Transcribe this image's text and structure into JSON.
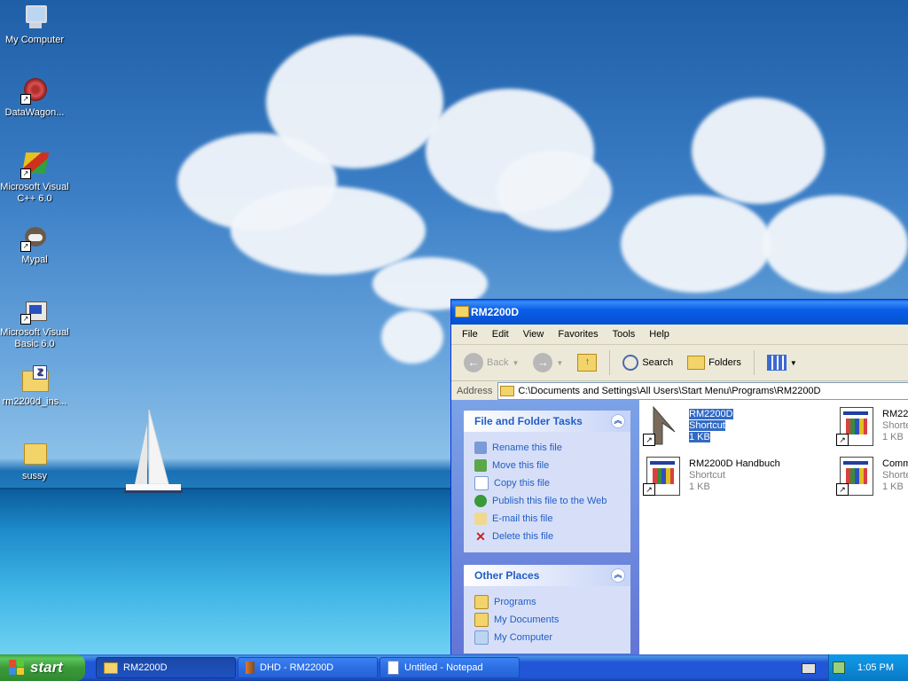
{
  "desktop": {
    "icons": [
      {
        "label": "My Computer"
      },
      {
        "label": "DataWagon..."
      },
      {
        "label": "Microsoft Visual C++ 6.0"
      },
      {
        "label": "Mypal"
      },
      {
        "label": "Microsoft Visual Basic 6.0"
      },
      {
        "label": "rm2200d_ins..."
      },
      {
        "label": "sussy"
      }
    ]
  },
  "window": {
    "title": "RM2200D",
    "menu": [
      "File",
      "Edit",
      "View",
      "Favorites",
      "Tools",
      "Help"
    ],
    "toolbar": {
      "back": "Back",
      "search": "Search",
      "folders": "Folders"
    },
    "address": {
      "label": "Address",
      "value": "C:\\Documents and Settings\\All Users\\Start Menu\\Programs\\RM2200D"
    },
    "tasks_panel": {
      "title": "File and Folder Tasks",
      "items": [
        "Rename this file",
        "Move this file",
        "Copy this file",
        "Publish this file to the Web",
        "E-mail this file",
        "Delete this file"
      ]
    },
    "places_panel": {
      "title": "Other Places",
      "items": [
        "Programs",
        "My Documents",
        "My Computer"
      ]
    },
    "files": [
      {
        "name": "RM2200D",
        "type": "Shortcut",
        "size": "1 KB"
      },
      {
        "name": "RM22",
        "type": "Shorte",
        "size": "1 KB"
      },
      {
        "name": "RM2200D Handbuch",
        "type": "Shortcut",
        "size": "1 KB"
      },
      {
        "name": "Comm",
        "type": "Shorte",
        "size": "1 KB"
      }
    ]
  },
  "taskbar": {
    "start": "start",
    "items": [
      "RM2200D",
      "DHD - RM2200D",
      "Untitled - Notepad"
    ],
    "clock": "1:05 PM"
  }
}
